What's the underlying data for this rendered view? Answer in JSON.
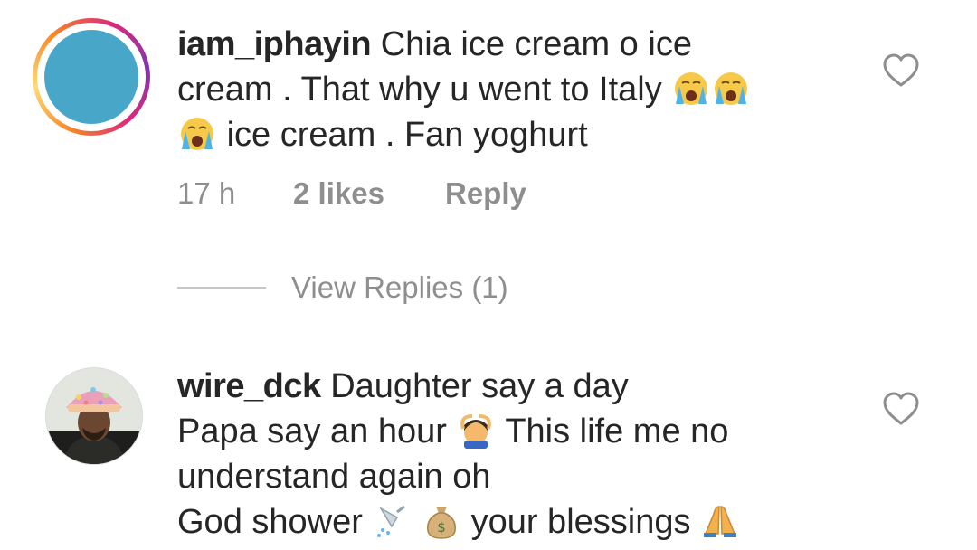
{
  "comments": [
    {
      "username": "iam_iphayin",
      "lines": [
        {
          "text_before": "Chia ice cream o ice",
          "text_after": ""
        },
        {
          "text_before": "cream . That why u went to Italy",
          "text_after": ""
        },
        {
          "text_before": "",
          "text_after": "ice cream . Fan yoghurt"
        }
      ],
      "time": "17 h",
      "likes": "2 likes",
      "reply_label": "Reply",
      "view_replies": "View Replies (1)",
      "avatar_color": "#48a7c9",
      "icons": [
        "loudly-crying-face-icon",
        "heart-outline-icon"
      ]
    },
    {
      "username": "wire_dck",
      "lines": [
        {
          "text_before": "Daughter say a day",
          "text_after": ""
        },
        {
          "text_before": "Papa say an hour",
          "text_after": "This life me no"
        },
        {
          "text_before": "understand again oh",
          "text_after": ""
        },
        {
          "text_before": "God shower",
          "text_after": "your blessings"
        }
      ],
      "icons": [
        "person-gesturing-ok-icon",
        "shower-icon",
        "money-bag-icon",
        "folded-hands-icon",
        "heart-outline-icon"
      ]
    }
  ]
}
